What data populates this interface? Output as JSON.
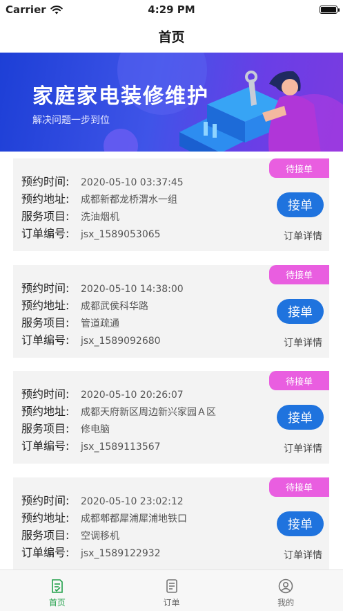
{
  "status_bar": {
    "carrier": "Carrier",
    "time": "4:29 PM"
  },
  "nav": {
    "title": "首页"
  },
  "banner": {
    "title": "家庭家电装修维护",
    "subtitle": "解决问题一步到位"
  },
  "labels": {
    "time": "预约时间:",
    "address": "预约地址:",
    "service": "服务项目:",
    "order_no": "订单编号:"
  },
  "orders": [
    {
      "status": "待接单",
      "time": "2020-05-10 03:37:45",
      "address": "成都新都龙桥渭水一组",
      "service": "洗油烟机",
      "order_no": "jsx_1589053065",
      "accept_label": "接单",
      "detail_label": "订单详情"
    },
    {
      "status": "待接单",
      "time": "2020-05-10 14:38:00",
      "address": "成都武侯科华路",
      "service": "管道疏通",
      "order_no": "jsx_1589092680",
      "accept_label": "接单",
      "detail_label": "订单详情"
    },
    {
      "status": "待接单",
      "time": "2020-05-10 20:26:07",
      "address": "成都天府新区周边新兴家园Ａ区",
      "service": "修电脑",
      "order_no": "jsx_1589113567",
      "accept_label": "接单",
      "detail_label": "订单详情"
    },
    {
      "status": "待接单",
      "time": "2020-05-10 23:02:12",
      "address": "成都郫都犀浦犀浦地铁口",
      "service": "空调移机",
      "order_no": "jsx_1589122932",
      "accept_label": "接单",
      "detail_label": "订单详情"
    }
  ],
  "tabs": [
    {
      "label": "首页",
      "icon": "home-order-icon",
      "active": true
    },
    {
      "label": "订单",
      "icon": "order-list-icon",
      "active": false
    },
    {
      "label": "我的",
      "icon": "profile-icon",
      "active": false
    }
  ],
  "colors": {
    "accent": "#1f73de",
    "badge": "#e95ee0",
    "tab_active": "#22a04a",
    "banner": "#3f54e8"
  }
}
